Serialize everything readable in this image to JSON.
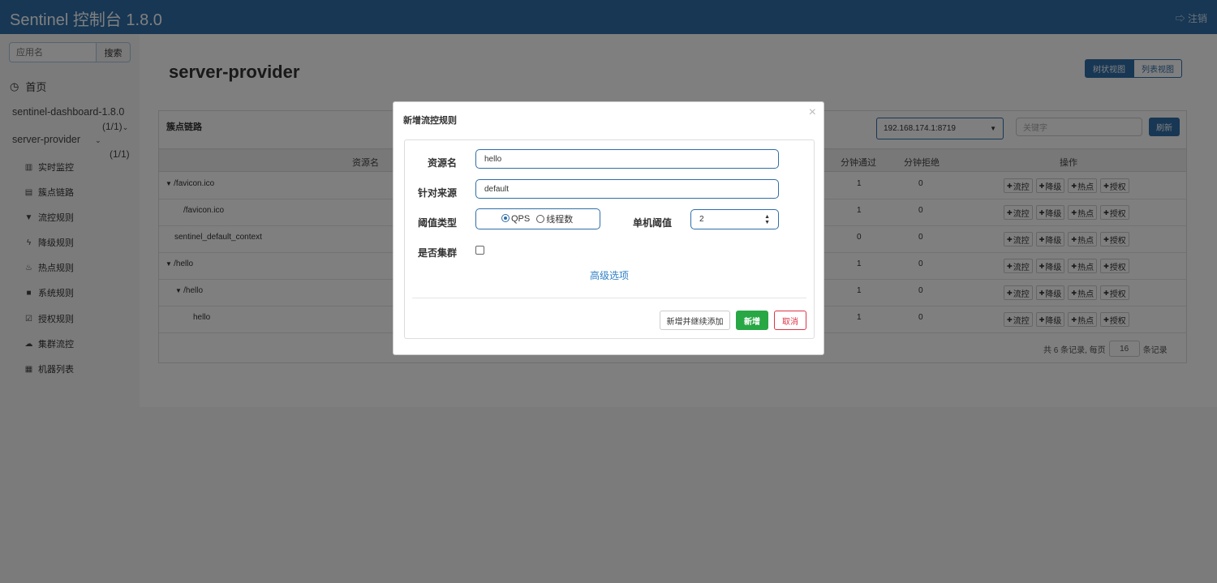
{
  "header": {
    "brand": "Sentinel 控制台 1.8.0",
    "logout": "注销"
  },
  "sidebar": {
    "search_placeholder": "应用名",
    "search_button": "搜索",
    "home": "首页",
    "apps": [
      {
        "name": "sentinel-dashboard-1.8.0",
        "count": "(1/1)"
      },
      {
        "name": "server-provider",
        "count": "(1/1)"
      }
    ],
    "menu": [
      {
        "label": "实时监控",
        "icon": "bar-chart-icon"
      },
      {
        "label": "簇点链路",
        "icon": "list-icon"
      },
      {
        "label": "流控规则",
        "icon": "filter-icon"
      },
      {
        "label": "降级规则",
        "icon": "flash-icon"
      },
      {
        "label": "热点规则",
        "icon": "fire-icon"
      },
      {
        "label": "系统规则",
        "icon": "lock-icon"
      },
      {
        "label": "授权规则",
        "icon": "check-square-icon"
      },
      {
        "label": "集群流控",
        "icon": "cloud-icon"
      },
      {
        "label": "机器列表",
        "icon": "grid-icon"
      }
    ]
  },
  "main": {
    "title": "server-provider",
    "view_tree": "树状视图",
    "view_list": "列表视图",
    "panel_title": "簇点链路",
    "machine": "192.168.174.1:8719",
    "keyword_placeholder": "关键字",
    "refresh": "刷新",
    "columns": {
      "resource": "资源名",
      "pass_minute": "分钟通过",
      "block_minute": "分钟拒绝",
      "ops": "操作"
    },
    "rows": [
      {
        "name": "/favicon.ico",
        "toggle": "▼",
        "indent": 0,
        "pass": "1",
        "block": "0"
      },
      {
        "name": "/favicon.ico",
        "toggle": "",
        "indent": 1,
        "pass": "1",
        "block": "0"
      },
      {
        "name": "sentinel_default_context",
        "toggle": "",
        "indent": 0,
        "pass": "0",
        "block": "0"
      },
      {
        "name": "/hello",
        "toggle": "▼",
        "indent": 0,
        "pass": "1",
        "block": "0"
      },
      {
        "name": "/hello",
        "toggle": "▼",
        "indent": 1,
        "pass": "1",
        "block": "0"
      },
      {
        "name": "hello",
        "toggle": "",
        "indent": 2,
        "pass": "1",
        "block": "0"
      }
    ],
    "op_labels": [
      "流控",
      "降级",
      "热点",
      "授权"
    ],
    "pager": {
      "prefix": "共 6 条记录, 每页",
      "page_size": "16",
      "suffix": "条记录"
    }
  },
  "modal": {
    "title": "新增流控规则",
    "close": "×",
    "resource_label": "资源名",
    "resource_value": "hello",
    "origin_label": "针对来源",
    "origin_value": "default",
    "grade_label": "阈值类型",
    "grade_qps": "QPS",
    "grade_threads": "线程数",
    "grade_selected": "QPS",
    "threshold_label": "单机阈值",
    "threshold_value": "2",
    "cluster_label": "是否集群",
    "cluster_checked": false,
    "advanced": "高级选项",
    "btn_continue": "新增并继续添加",
    "btn_add": "新增",
    "btn_cancel": "取消"
  }
}
